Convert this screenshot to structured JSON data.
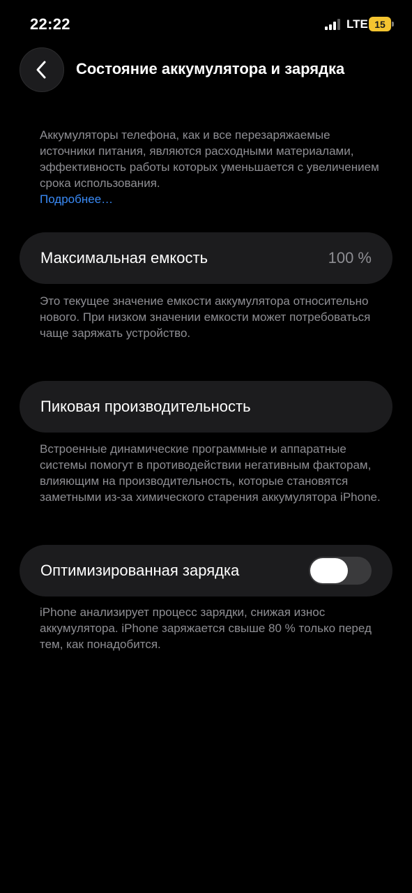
{
  "status_bar": {
    "time": "22:22",
    "network": "LTE",
    "battery_level": "15",
    "icons": [
      "signal-icon",
      "battery-icon"
    ]
  },
  "nav": {
    "back_icon": "chevron-left-icon",
    "title": "Состояние аккумулятора и зарядка"
  },
  "intro": {
    "text": "Аккумуляторы телефона, как и все перезаряжае­мые источники питания, являются расходными материалами, эффективность работы которых уменьшается с увеличением срока использования.",
    "link": "Подробнее…"
  },
  "max_capacity": {
    "label": "Максимальная емкость",
    "value": "100 %",
    "note": "Это текущее значение емкости аккумулятора относительно нового. При низком значении емкости может потребоваться чаще заряжать устройство."
  },
  "peak_performance": {
    "label": "Пиковая производительность",
    "note": "Встроенные динамические программные и аппаратные системы помогут в противодействии негативным факторам, влияющим на производи­тельность, которые становятся заметными из-за химического старения аккумулятора iPhone."
  },
  "optimized_charging": {
    "label": "Оптимизированная зарядка",
    "enabled": false,
    "note": "iPhone анализирует процесс зарядки, снижая износ аккумулятора. iPhone заряжается свыше 80 % только перед тем, как понадобится."
  },
  "colors": {
    "background": "#000000",
    "card": "#1c1c1e",
    "secondary_text": "#8e8e93",
    "link": "#3a8bf7",
    "battery_low": "#f4c430",
    "toggle_off": "#3a3a3c"
  }
}
